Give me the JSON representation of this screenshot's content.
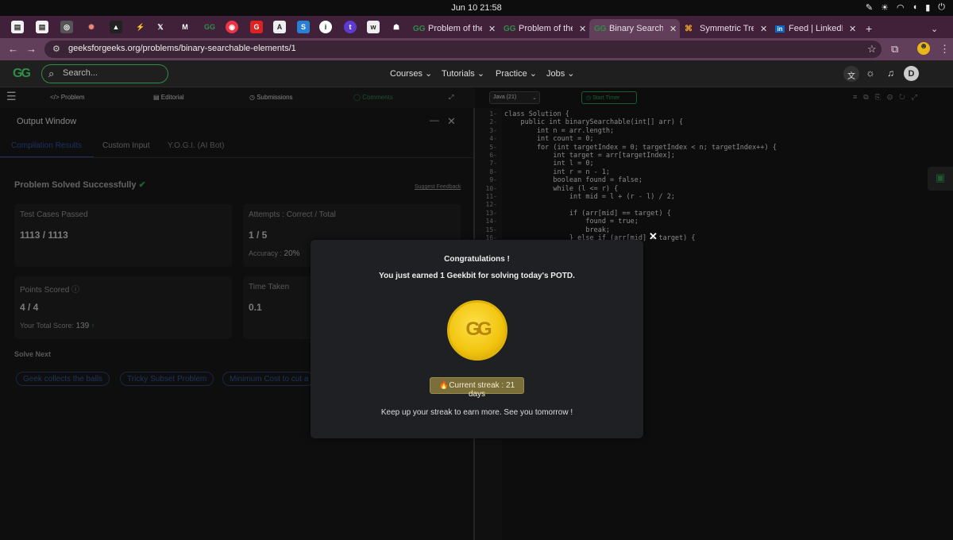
{
  "os": {
    "clock": "Jun 10  21:58"
  },
  "tabs": [
    {
      "title": "Problem of the",
      "icon": "gfg-icon"
    },
    {
      "title": "Problem of the",
      "icon": "gfg-icon"
    },
    {
      "title": "Binary Searchal",
      "icon": "gfg-icon",
      "active": true
    },
    {
      "title": "Symmetric Tree",
      "icon": "lc-icon"
    },
    {
      "title": "Feed | LinkedIn",
      "icon": "linkedin-icon"
    }
  ],
  "address": {
    "url": "geeksforgeeks.org/problems/binary-searchable-elements/1"
  },
  "header": {
    "logo": "GG",
    "search_placeholder": "Search...",
    "nav": [
      "Courses",
      "Tutorials",
      "Practice",
      "Jobs"
    ],
    "avatar": "D"
  },
  "toolbar": {
    "problem": "Problem",
    "editorial": "Editorial",
    "submissions": "Submissions",
    "comments": "Comments",
    "language": "Java (21)",
    "timer": "Start Timer"
  },
  "output": {
    "title": "Output Window",
    "tabs": [
      "Compilation Results",
      "Custom Input",
      "Y.O.G.I. (AI Bot)"
    ],
    "status": "Problem Solved Successfully",
    "suggest": "Suggest Feedback",
    "test_label": "Test Cases Passed",
    "test_value": "1113 / 1113",
    "attempts_label": "Attempts : Correct / Total",
    "attempts_value": "1 / 5",
    "accuracy_label": "Accuracy :",
    "accuracy_value": "20%",
    "points_label": "Points Scored",
    "points_value": "4 / 4",
    "total_label": "Your Total Score:",
    "total_value": "139",
    "time_label": "Time Taken",
    "time_value": "0.1",
    "solve_next": "Solve Next",
    "next": [
      "Geek collects the balls",
      "Tricky Subset Problem",
      "Minimum Cost to cut a"
    ]
  },
  "code": [
    "class Solution {",
    "    public int binarySearchable(int[] arr) {",
    "        int n = arr.length;",
    "        int count = 0;",
    "        for (int targetIndex = 0; targetIndex < n; targetIndex++) {",
    "            int target = arr[targetIndex];",
    "            int l = 0;",
    "            int r = n - 1;",
    "            boolean found = false;",
    "            while (l <= r) {",
    "                int mid = l + (r - l) / 2;",
    "",
    "                if (arr[mid] == target) {",
    "                    found = true;",
    "                    break;",
    "                } else if (arr[mid] < target) {"
  ],
  "modal": {
    "title": "Congratulations !",
    "subtitle": "You just earned 1 Geekbit for solving today's POTD.",
    "coin": "GG",
    "streak": "Current streak : 21 days",
    "footer": "Keep up your streak to earn more. See you tomorrow !"
  }
}
